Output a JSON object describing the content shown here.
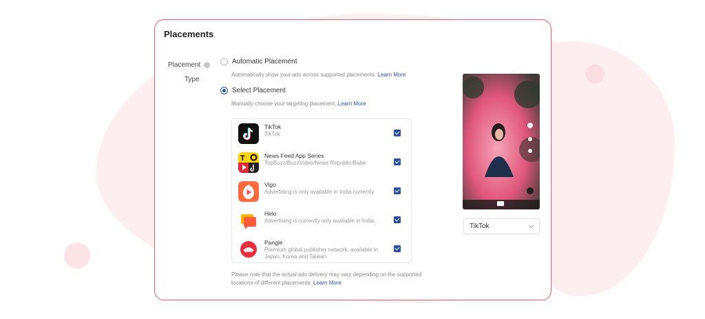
{
  "section": {
    "title": "Placements"
  },
  "field": {
    "label_line1": "Placement",
    "label_line2": "Type"
  },
  "automatic": {
    "label": "Automatic Placement",
    "help": "Automatically show your ads across supported placements.",
    "learn_more": "Learn More"
  },
  "select": {
    "label": "Select Placement",
    "help": "Manually choose your targeting placement.",
    "learn_more": "Learn More"
  },
  "placements": [
    {
      "name": "TikTok",
      "desc": "TikTok",
      "checked": true,
      "icon": "tiktok-icon"
    },
    {
      "name": "News Feed App Series",
      "desc": "TopBuzz/BuzzVideo/News Republic/Babe",
      "checked": true,
      "icon": "news-feed-icon"
    },
    {
      "name": "Vigo",
      "desc": "Advertising is only available in India currently.",
      "checked": true,
      "icon": "vigo-icon"
    },
    {
      "name": "Helo",
      "desc": "Advertising is currently only available in India.",
      "checked": true,
      "icon": "helo-icon"
    },
    {
      "name": "Pangle",
      "desc": "Premium global publisher network, available in Japan, Korea and Taiwan",
      "checked": true,
      "icon": "pangle-icon"
    }
  ],
  "note": {
    "text": "Please note that the actual ads delivery may vary depending on the supported locations of different placements.",
    "learn_more": "Learn More"
  },
  "preview": {
    "selected": "TikTok"
  },
  "colors": {
    "accent": "#2d4fa0",
    "border": "#ee5a72",
    "blob": "#fdeef0"
  }
}
